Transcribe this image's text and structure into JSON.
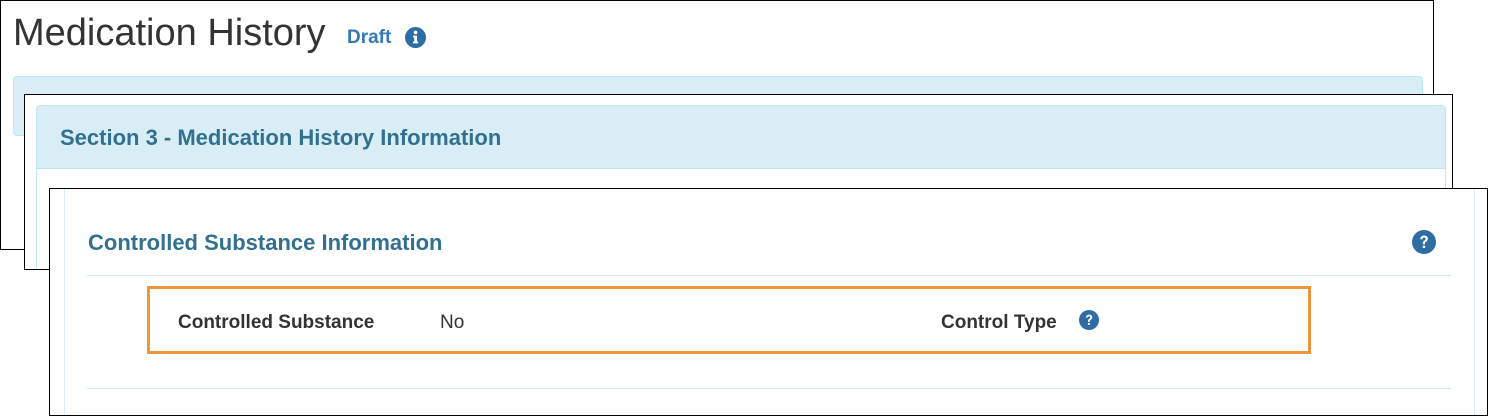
{
  "page": {
    "title": "Medication History",
    "status": "Draft"
  },
  "section": {
    "heading": "Section 3 - Medication History Information"
  },
  "controlled_substance": {
    "title": "Controlled Substance Information",
    "fields": [
      {
        "label": "Controlled Substance",
        "value": "No"
      },
      {
        "label": "Control Type",
        "value": ""
      }
    ]
  },
  "icons": {
    "info": "info-circle-icon",
    "help": "question-circle-icon"
  },
  "colors": {
    "link_blue": "#337ab7",
    "heading_blue": "#31708f",
    "panel_bg": "#d9edf7",
    "highlight_orange": "#f0963a",
    "icon_blue": "#2e6da4"
  }
}
